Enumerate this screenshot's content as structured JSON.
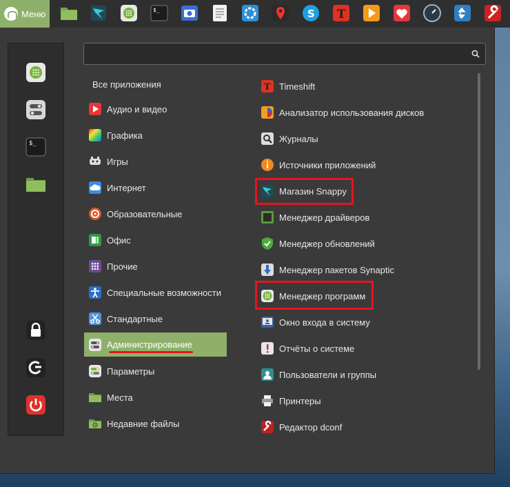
{
  "panel": {
    "menu_label": "Меню",
    "launchers": [
      "folder-icon",
      "snap-store-icon",
      "software-manager-icon",
      "terminal-icon",
      "camera-icon",
      "text-editor-icon",
      "settings-flower-icon",
      "location-pin-icon",
      "skype-icon",
      "typora-icon",
      "media-player-icon",
      "heart-icon",
      "timeshift-gauge-icon",
      "updown-icon",
      "wrench-icon"
    ]
  },
  "search": {
    "value": "",
    "placeholder": ""
  },
  "sidebar": [
    "software-manager-icon",
    "settings-toggle-icon",
    "terminal-icon",
    "folder-icon",
    "lock-icon",
    "logout-icon",
    "power-icon"
  ],
  "all_apps_label": "Все приложения",
  "categories": [
    {
      "label": "Аудио и видео",
      "icon": "play-icon"
    },
    {
      "label": "Графика",
      "icon": "graphics-icon"
    },
    {
      "label": "Игры",
      "icon": "gamepad-icon"
    },
    {
      "label": "Интернет",
      "icon": "cloud-icon"
    },
    {
      "label": "Образовательные",
      "icon": "education-icon"
    },
    {
      "label": "Офис",
      "icon": "office-icon"
    },
    {
      "label": "Прочие",
      "icon": "grid-icon"
    },
    {
      "label": "Специальные возможности",
      "icon": "accessibility-icon"
    },
    {
      "label": "Стандартные",
      "icon": "scissors-icon"
    },
    {
      "label": "Администрирование",
      "icon": "admin-toggle-icon"
    },
    {
      "label": "Параметры",
      "icon": "settings-toggle-icon"
    },
    {
      "label": "Места",
      "icon": "folder-icon"
    },
    {
      "label": "Недавние файлы",
      "icon": "recent-folder-icon"
    }
  ],
  "apps": [
    {
      "label": "Timeshift",
      "icon": "timeshift-icon"
    },
    {
      "label": "Анализатор использования дисков",
      "icon": "disk-usage-icon"
    },
    {
      "label": "Журналы",
      "icon": "magnifier-icon"
    },
    {
      "label": "Источники приложений",
      "icon": "sources-info-icon"
    },
    {
      "label": "Магазин Snappy",
      "icon": "snap-store-icon"
    },
    {
      "label": "Менеджер драйверов",
      "icon": "driver-chip-icon"
    },
    {
      "label": "Менеджер обновлений",
      "icon": "shield-icon"
    },
    {
      "label": "Менеджер пакетов Synaptic",
      "icon": "download-arrow-icon"
    },
    {
      "label": "Менеджер программ",
      "icon": "software-manager-icon"
    },
    {
      "label": "Окно входа в систему",
      "icon": "login-window-icon"
    },
    {
      "label": "Отчёты о системе",
      "icon": "warning-icon"
    },
    {
      "label": "Пользователи и группы",
      "icon": "user-icon"
    },
    {
      "label": "Принтеры",
      "icon": "printer-icon"
    },
    {
      "label": "Редактор dconf",
      "icon": "dconf-icon"
    }
  ],
  "colors": {
    "accent": "#8fb06a",
    "annotation_red": "#e8141d",
    "menu_bg": "#3a3a3a"
  }
}
